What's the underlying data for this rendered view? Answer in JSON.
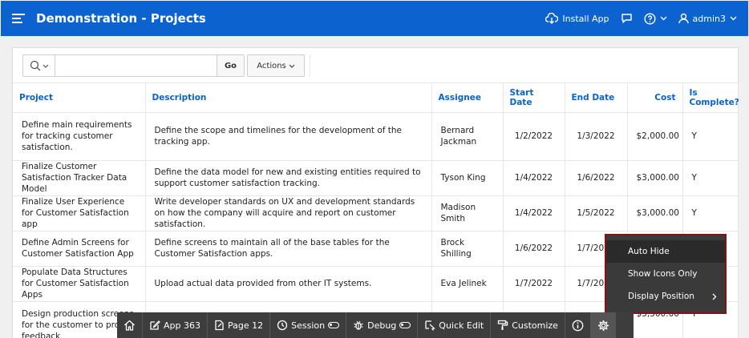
{
  "header": {
    "title": "Demonstration - Projects",
    "install_label": "Install App",
    "user_name": "admin3"
  },
  "search": {
    "value": "",
    "placeholder": "",
    "go_label": "Go",
    "actions_label": "Actions"
  },
  "table": {
    "columns": [
      "Project",
      "Description",
      "Assignee",
      "Start Date",
      "End Date",
      "Cost",
      "Is Complete?"
    ],
    "rows": [
      [
        "Define main requirements for tracking customer satisfaction.",
        "Define the scope and timelines for the development of the tracking app.",
        "Bernard Jackman",
        "1/2/2022",
        "1/3/2022",
        "$2,000.00",
        "Y"
      ],
      [
        "Finalize Customer Satisfaction Tracker Data Model",
        "Define the data model for new and existing entities required to support customer satisfaction tracking.",
        "Tyson King",
        "1/4/2022",
        "1/6/2022",
        "$3,000.00",
        "Y"
      ],
      [
        "Finalize User Experience for Customer Satisfaction app",
        "Write developer standards on UX and development standards on how the company will acquire and report on customer satisfaction.",
        "Madison Smith",
        "1/4/2022",
        "1/5/2022",
        "$3,000.00",
        "Y"
      ],
      [
        "Define Admin Screens for Customer Satisfaction App",
        "Define screens to maintain all of the base tables for the Customer Satisfaction apps.",
        "Brock Shilling",
        "1/6/2022",
        "1/7/2022",
        "",
        ""
      ],
      [
        "Populate Data Structures for Customer Satisfaction Apps",
        "Upload actual data provided from other IT systems.",
        "Eva Jelinek",
        "1/7/2022",
        "1/7/2022",
        "",
        ""
      ],
      [
        "Design production screens for the customer to provi feedback",
        "",
        "",
        "",
        "",
        "$3,500.00",
        "Y"
      ]
    ]
  },
  "devbar": {
    "app_label": "App 363",
    "page_label": "Page 12",
    "session_label": "Session",
    "debug_label": "Debug",
    "quick_edit_label": "Quick Edit",
    "customize_label": "Customize"
  },
  "menu": {
    "items": [
      "Auto Hide",
      "Show Icons Only",
      "Display Position"
    ]
  },
  "colors": {
    "header_bg": "#0c62cf",
    "link": "#0a63c9",
    "devbar_bg": "#3d3d3d",
    "menu_border": "#8b1010"
  }
}
